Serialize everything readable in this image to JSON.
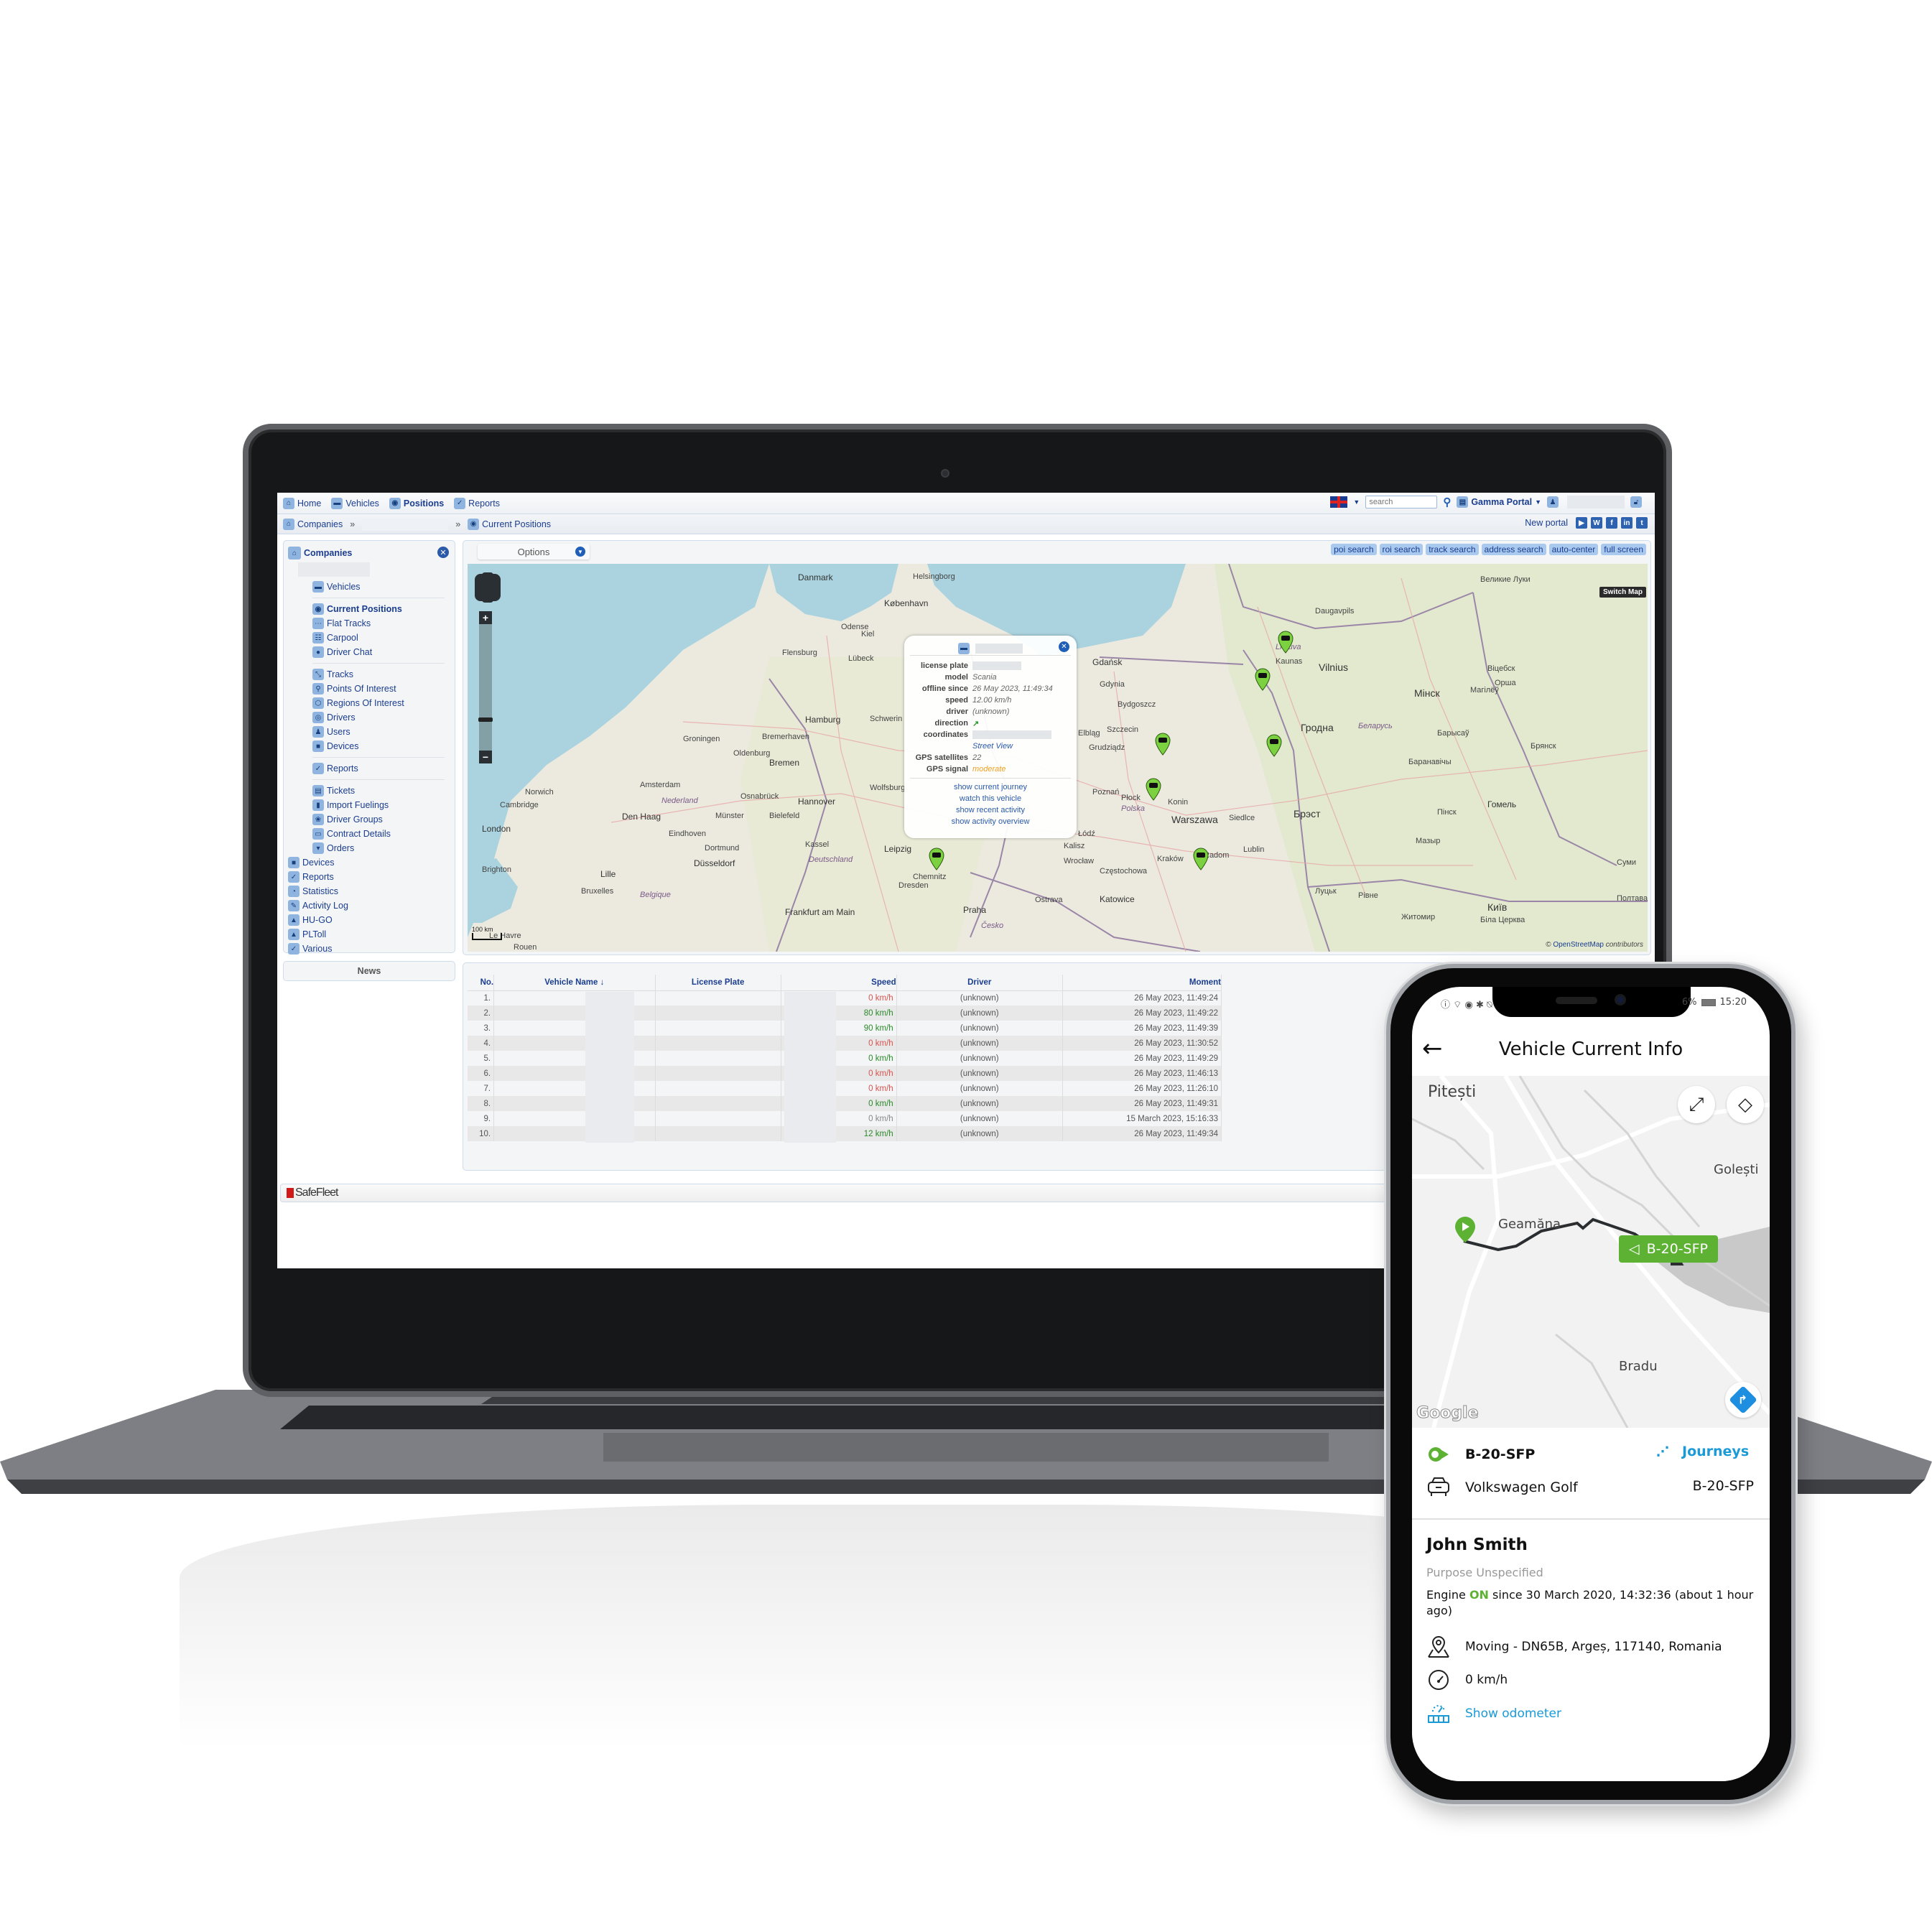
{
  "laptop": {
    "topnav": {
      "items": [
        {
          "label": "Home",
          "icon": "home-icon"
        },
        {
          "label": "Vehicles",
          "icon": "car-icon"
        },
        {
          "label": "Positions",
          "icon": "globe-icon",
          "active": true
        },
        {
          "label": "Reports",
          "icon": "reports-icon"
        }
      ],
      "language": "EN",
      "search_placeholder": "search",
      "portal_label": "Gamma Portal"
    },
    "breadcrumb": {
      "root": "Companies",
      "separator": "»",
      "current": "Current Positions",
      "new_portal": "New portal",
      "social": [
        "YouTube",
        "WordPress",
        "f",
        "in",
        "t"
      ]
    },
    "sidebar": {
      "title": "Companies",
      "sections": [
        [
          {
            "label": "Vehicles",
            "icon": "car-icon"
          }
        ],
        [
          {
            "label": "Current Positions",
            "icon": "globe-icon",
            "active": true
          },
          {
            "label": "Flat Tracks",
            "icon": "flat-tracks-icon"
          },
          {
            "label": "Carpool",
            "icon": "carpool-icon"
          },
          {
            "label": "Driver Chat",
            "icon": "chat-icon"
          }
        ],
        [
          {
            "label": "Tracks",
            "icon": "tracks-icon"
          },
          {
            "label": "Points Of Interest",
            "icon": "pin-icon"
          },
          {
            "label": "Regions Of Interest",
            "icon": "hexagon-icon"
          },
          {
            "label": "Drivers",
            "icon": "steering-wheel-icon"
          },
          {
            "label": "Users",
            "icon": "user-icon"
          },
          {
            "label": "Devices",
            "icon": "device-icon"
          }
        ],
        [
          {
            "label": "Reports",
            "icon": "reports-icon"
          }
        ],
        [
          {
            "label": "Tickets",
            "icon": "tickets-icon"
          },
          {
            "label": "Import Fuelings",
            "icon": "fuel-icon"
          },
          {
            "label": "Driver Groups",
            "icon": "groups-icon"
          },
          {
            "label": "Contract Details",
            "icon": "document-icon"
          },
          {
            "label": "Orders",
            "icon": "cart-icon"
          }
        ]
      ],
      "top_items": [
        {
          "label": "Devices",
          "icon": "device-icon"
        },
        {
          "label": "Reports",
          "icon": "reports-icon"
        },
        {
          "label": "Statistics",
          "icon": "gauge-icon"
        },
        {
          "label": "Activity Log",
          "icon": "log-icon"
        },
        {
          "label": "HU-GO",
          "icon": "warning-triangle-icon"
        },
        {
          "label": "PLToll",
          "icon": "warning-triangle-icon"
        },
        {
          "label": "Various",
          "icon": "reports-icon"
        }
      ],
      "news_label": "News"
    },
    "map": {
      "options_label": "Options",
      "buttons": [
        "poi search",
        "roi search",
        "track search",
        "address search",
        "auto-center",
        "full screen"
      ],
      "switch_map": "Switch Map",
      "scale_label": "100 km",
      "attribution_link": "OpenStreetMap",
      "attribution_text": "contributors",
      "labels": [
        {
          "t": "Danmark",
          "c": "city"
        },
        {
          "t": "Helsingborg",
          "c": ""
        },
        {
          "t": "København",
          "c": "city"
        },
        {
          "t": "Odense",
          "c": ""
        },
        {
          "t": "Flensburg",
          "c": ""
        },
        {
          "t": "Kiel",
          "c": ""
        },
        {
          "t": "Lübeck",
          "c": ""
        },
        {
          "t": "Hamburg",
          "c": "city"
        },
        {
          "t": "Schwerin",
          "c": ""
        },
        {
          "t": "Bremerhaven",
          "c": ""
        },
        {
          "t": "Bremen",
          "c": "city"
        },
        {
          "t": "Groningen",
          "c": ""
        },
        {
          "t": "Oldenburg",
          "c": ""
        },
        {
          "t": "Hannover",
          "c": "city"
        },
        {
          "t": "Wolfsburg",
          "c": ""
        },
        {
          "t": "Osnabrück",
          "c": ""
        },
        {
          "t": "Amsterdam",
          "c": ""
        },
        {
          "t": "Nederland",
          "c": "reg"
        },
        {
          "t": "Den Haag",
          "c": "city"
        },
        {
          "t": "Münster",
          "c": ""
        },
        {
          "t": "Bielefeld",
          "c": ""
        },
        {
          "t": "Eindhoven",
          "c": ""
        },
        {
          "t": "Dortmund",
          "c": ""
        },
        {
          "t": "Düsseldorf",
          "c": "city"
        },
        {
          "t": "Kassel",
          "c": ""
        },
        {
          "t": "Deutschland",
          "c": "reg"
        },
        {
          "t": "Leipzig",
          "c": "city"
        },
        {
          "t": "Dresden",
          "c": ""
        },
        {
          "t": "Chemnitz",
          "c": ""
        },
        {
          "t": "Frankfurt am Main",
          "c": "city"
        },
        {
          "t": "Bruxelles",
          "c": ""
        },
        {
          "t": "Belgique",
          "c": "reg"
        },
        {
          "t": "Lille",
          "c": "city"
        },
        {
          "t": "Rouen",
          "c": ""
        },
        {
          "t": "Le Havre",
          "c": ""
        },
        {
          "t": "London",
          "c": "city"
        },
        {
          "t": "Cambridge",
          "c": ""
        },
        {
          "t": "Brighton",
          "c": ""
        },
        {
          "t": "Norwich",
          "c": ""
        },
        {
          "t": "Praha",
          "c": "city"
        },
        {
          "t": "Česko",
          "c": "reg"
        },
        {
          "t": "Wrocław",
          "c": ""
        },
        {
          "t": "Poznań",
          "c": ""
        },
        {
          "t": "Szczecin",
          "c": ""
        },
        {
          "t": "Gdańsk",
          "c": "city"
        },
        {
          "t": "Gdynia",
          "c": ""
        },
        {
          "t": "Elbląg",
          "c": ""
        },
        {
          "t": "Bydgoszcz",
          "c": ""
        },
        {
          "t": "Grudziądz",
          "c": ""
        },
        {
          "t": "Płock",
          "c": ""
        },
        {
          "t": "Konin",
          "c": ""
        },
        {
          "t": "Polska",
          "c": "reg"
        },
        {
          "t": "Warszawa",
          "c": "big"
        },
        {
          "t": "Siedlce",
          "c": ""
        },
        {
          "t": "Łódź",
          "c": ""
        },
        {
          "t": "Kalisz",
          "c": ""
        },
        {
          "t": "Częstochowa",
          "c": ""
        },
        {
          "t": "Katowice",
          "c": "city"
        },
        {
          "t": "Kraków",
          "c": ""
        },
        {
          "t": "Radom",
          "c": ""
        },
        {
          "t": "Lublin",
          "c": ""
        },
        {
          "t": "Ostrava",
          "c": ""
        },
        {
          "t": "Kaunas",
          "c": ""
        },
        {
          "t": "Vilnius",
          "c": "big"
        },
        {
          "t": "Lietuva",
          "c": "reg"
        },
        {
          "t": "Daugavpils",
          "c": ""
        },
        {
          "t": "Гродна",
          "c": "big"
        },
        {
          "t": "Брэст",
          "c": "big"
        },
        {
          "t": "Беларусь",
          "c": "reg"
        },
        {
          "t": "Мінск",
          "c": "big"
        },
        {
          "t": "Баранавічы",
          "c": ""
        },
        {
          "t": "Пінск",
          "c": ""
        },
        {
          "t": "Мазыр",
          "c": ""
        },
        {
          "t": "Гомель",
          "c": "city"
        },
        {
          "t": "Барысаў",
          "c": ""
        },
        {
          "t": "Магілёў",
          "c": ""
        },
        {
          "t": "Віцебск",
          "c": ""
        },
        {
          "t": "Орша",
          "c": ""
        },
        {
          "t": "Брянск",
          "c": ""
        },
        {
          "t": "Великие Луки",
          "c": ""
        },
        {
          "t": "Луцьк",
          "c": ""
        },
        {
          "t": "Рівне",
          "c": ""
        },
        {
          "t": "Житомир",
          "c": ""
        },
        {
          "t": "Київ",
          "c": "big"
        },
        {
          "t": "Біла Церква",
          "c": ""
        },
        {
          "t": "Суми",
          "c": ""
        },
        {
          "t": "Полтава",
          "c": ""
        }
      ]
    },
    "popup": {
      "fields": [
        {
          "k": "license plate",
          "v": "",
          "redacted": true
        },
        {
          "k": "model",
          "v": "Scania"
        },
        {
          "k": "offline since",
          "v": "26 May 2023, 11:49:34"
        },
        {
          "k": "speed",
          "v": "12.00 km/h"
        },
        {
          "k": "driver",
          "v": "(unknown)"
        },
        {
          "k": "direction",
          "v": "↗"
        },
        {
          "k": "coordinates",
          "v": "",
          "redacted": true
        },
        {
          "k": "",
          "v": "Street View",
          "link": true
        },
        {
          "k": "GPS satellites",
          "v": "22"
        },
        {
          "k": "GPS signal",
          "v": "moderate",
          "color": "#f0a020"
        }
      ],
      "links": [
        "show current journey",
        "watch this vehicle",
        "show recent activity",
        "show activity overview"
      ]
    },
    "table": {
      "columns": [
        "No.",
        "Vehicle Name ↓",
        "License Plate",
        "Speed",
        "Driver",
        "Moment"
      ],
      "rows": [
        {
          "no": "1.",
          "speed": "0 km/h",
          "status": "red",
          "driver": "(unknown)",
          "moment": "26 May 2023, 11:49:24"
        },
        {
          "no": "2.",
          "speed": "80 km/h",
          "status": "green",
          "driver": "(unknown)",
          "moment": "26 May 2023, 11:49:22"
        },
        {
          "no": "3.",
          "speed": "90 km/h",
          "status": "green",
          "driver": "(unknown)",
          "moment": "26 May 2023, 11:49:39"
        },
        {
          "no": "4.",
          "speed": "0 km/h",
          "status": "red",
          "driver": "(unknown)",
          "moment": "26 May 2023, 11:30:52"
        },
        {
          "no": "5.",
          "speed": "0 km/h",
          "status": "green",
          "driver": "(unknown)",
          "moment": "26 May 2023, 11:49:29"
        },
        {
          "no": "6.",
          "speed": "0 km/h",
          "status": "red",
          "driver": "(unknown)",
          "moment": "26 May 2023, 11:46:13"
        },
        {
          "no": "7.",
          "speed": "0 km/h",
          "status": "red",
          "driver": "(unknown)",
          "moment": "26 May 2023, 11:26:10"
        },
        {
          "no": "8.",
          "speed": "0 km/h",
          "status": "green",
          "driver": "(unknown)",
          "moment": "26 May 2023, 11:49:31"
        },
        {
          "no": "9.",
          "speed": "0 km/h",
          "status": "gray",
          "driver": "(unknown)",
          "moment": "15 March 2023, 15:16:33"
        },
        {
          "no": "10.",
          "speed": "12 km/h",
          "status": "green",
          "driver": "(unknown)",
          "moment": "26 May 2023, 11:49:34"
        }
      ]
    },
    "footer_logo": "SafeFleet"
  },
  "phone": {
    "status_bar": {
      "battery": "6%",
      "time": "15:20"
    },
    "title": "Vehicle Current Info",
    "map": {
      "labels": [
        "Pitești",
        "Golești",
        "Geamăna",
        "Bradu"
      ],
      "vehicle_tag": "B-20-SFP",
      "google": "Google"
    },
    "vehicle": {
      "plate": "B-20-SFP",
      "journeys_label": "Journeys",
      "model": "Volkswagen Golf",
      "plate_right": "B-20-SFP"
    },
    "driver": {
      "name": "John Smith",
      "purpose": "Purpose Unspecified",
      "engine_prefix": "Engine",
      "engine_state": "ON",
      "engine_suffix": "since 30 March 2020, 14:32:36 (about 1 hour ago)",
      "location": "Moving - DN65B, Argeș, 117140, Romania",
      "speed": "0 km/h",
      "odometer_link": "Show odometer"
    },
    "colors": {
      "accent_green": "#5db233",
      "link_blue": "#1a9ad6"
    }
  }
}
